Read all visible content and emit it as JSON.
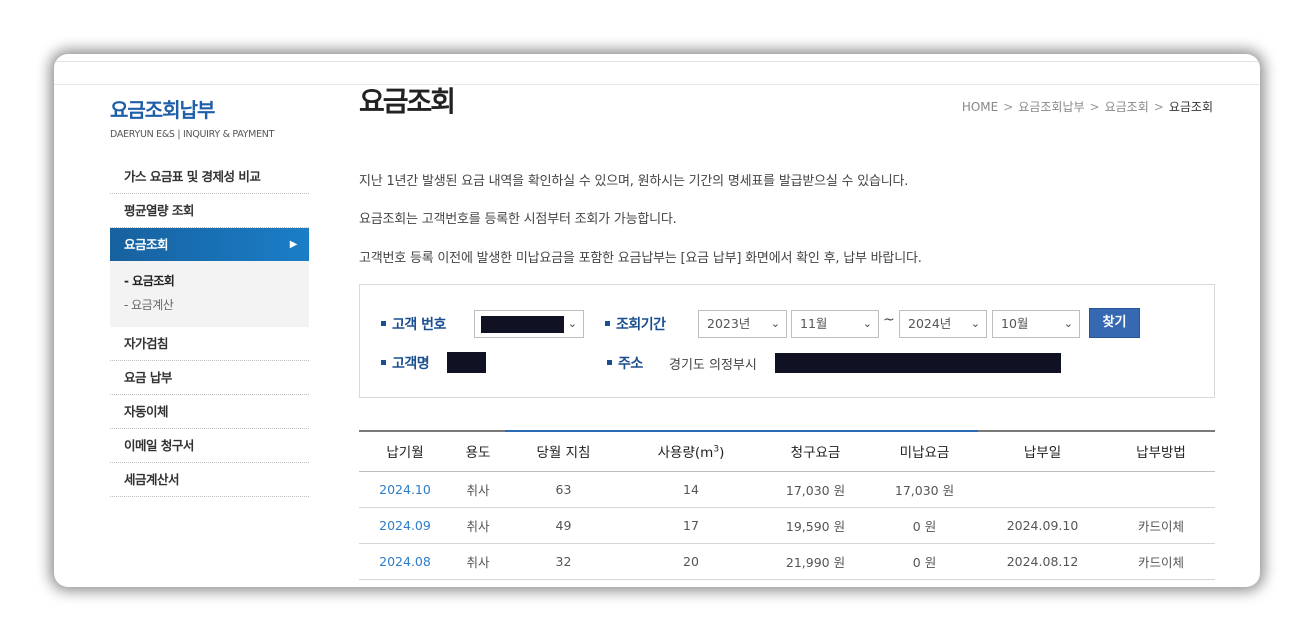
{
  "sidebar": {
    "title": "요금조회납부",
    "subtitle": "DAERYUN E&S | INQUIRY & PAYMENT",
    "items": [
      {
        "label": "가스 요금표 및 경제성 비교"
      },
      {
        "label": "평균열량 조회"
      },
      {
        "label": "요금조회",
        "active": true
      },
      {
        "label": "자가검침"
      },
      {
        "label": "요금 납부"
      },
      {
        "label": "자동이체"
      },
      {
        "label": "이메일 청구서"
      },
      {
        "label": "세금계산서"
      }
    ],
    "subitems": [
      "- 요금조회",
      "- 요금계산"
    ],
    "active_arrow": "▶"
  },
  "page": {
    "title": "요금조회",
    "breadcrumb": [
      "HOME",
      "요금조회납부",
      "요금조회",
      "요금조회"
    ],
    "separator": ">"
  },
  "descriptions": [
    "지난 1년간 발생된 요금 내역을 확인하실 수 있으며, 원하시는 기간의 명세표를 발급받으실 수 있습니다.",
    "요금조회는 고객번호를 등록한 시점부터 조회가 가능합니다.",
    "고객번호 등록 이전에 발생한 미납요금을 포함한 요금납부는 [요금 납부] 화면에서 확인 후, 납부 바랍니다."
  ],
  "search": {
    "customer_no_label": "고객 번호",
    "period_label": "조회기간",
    "customer_name_label": "고객명",
    "address_label": "주소",
    "address_value": "경기도 의정부시",
    "start_year": "2023년",
    "start_month": "11월",
    "end_year": "2024년",
    "end_month": "10월",
    "tilde": "~",
    "button_label": "찾기",
    "chevron": "⌄"
  },
  "table": {
    "headers": [
      "납기월",
      "용도",
      "당월 지침",
      "사용량(m",
      "청구요금",
      "미납요금",
      "납부일",
      "납부방법"
    ],
    "usage_unit_sup": "3",
    "usage_close": ")",
    "rows": [
      {
        "month": "2024.10",
        "use": "취사",
        "reading": "63",
        "usage": "14",
        "billed": "17,030 원",
        "unpaid": "17,030 원",
        "paid_date": "",
        "method": ""
      },
      {
        "month": "2024.09",
        "use": "취사",
        "reading": "49",
        "usage": "17",
        "billed": "19,590 원",
        "unpaid": "0 원",
        "paid_date": "2024.09.10",
        "method": "카드이체"
      },
      {
        "month": "2024.08",
        "use": "취사",
        "reading": "32",
        "usage": "20",
        "billed": "21,990 원",
        "unpaid": "0 원",
        "paid_date": "2024.08.12",
        "method": "카드이체"
      }
    ]
  },
  "colors": {
    "brand": "#1f5fa8",
    "accent_link": "#2f7cc9",
    "button": "#3769b3",
    "mask": "#101223"
  }
}
